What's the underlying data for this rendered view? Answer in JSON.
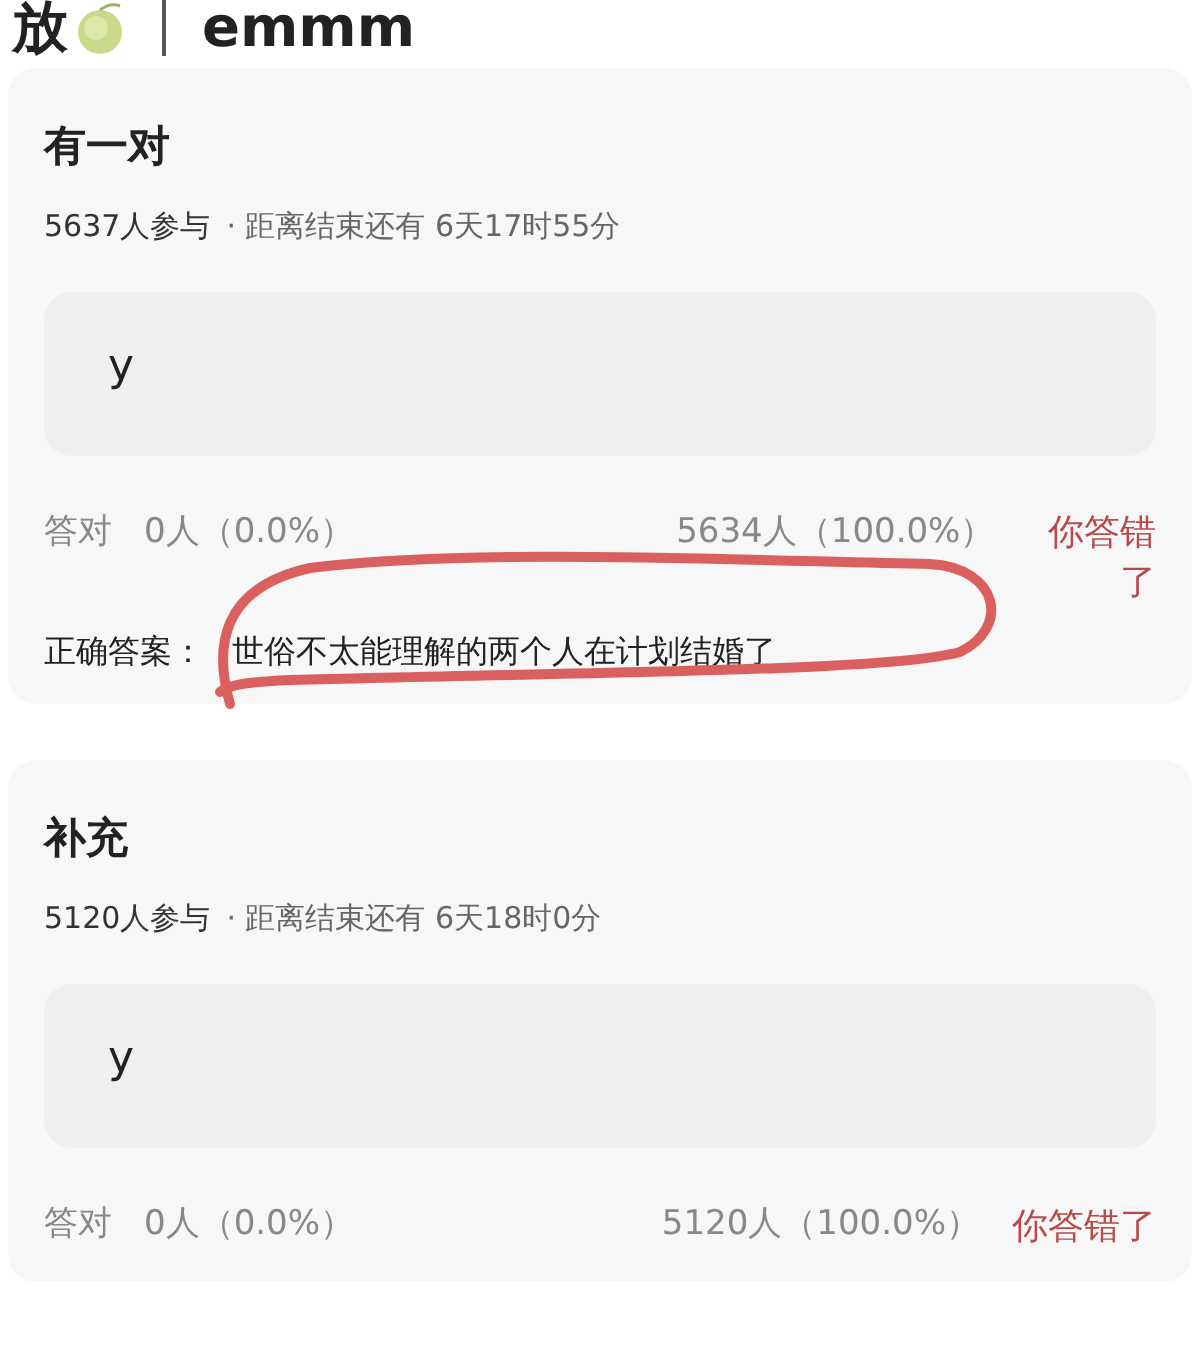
{
  "header": {
    "prefix": "放",
    "title": "emmm"
  },
  "questions": [
    {
      "title": "有一对",
      "participants": "5637人参与",
      "deadline": "· 距离结束还有 6天17时55分",
      "answer": "y",
      "correct_label": "答对",
      "correct_count": "0人（0.0%）",
      "wrong_count": "5634人（100.0%）",
      "result": "你答错了",
      "correct_answer_label": "正确答案：",
      "correct_answer": "世俗不太能理解的两个人在计划结婚了",
      "circled": true
    },
    {
      "title": "补充",
      "participants": "5120人参与",
      "deadline": "· 距离结束还有 6天18时0分",
      "answer": "y",
      "correct_label": "答对",
      "correct_count": "0人（0.0%）",
      "wrong_count": "5120人（100.0%）",
      "result": "你答错了",
      "circled": false
    }
  ]
}
